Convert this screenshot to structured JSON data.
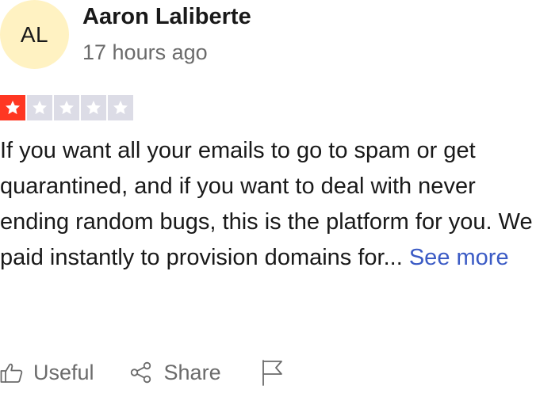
{
  "reviewer": {
    "initials": "AL",
    "name": "Aaron Laliberte",
    "date": "17 hours ago"
  },
  "rating": {
    "stars": 1,
    "max": 5,
    "filled_color": "#ff3722",
    "empty_color": "#dcdce6"
  },
  "review": {
    "text": "If you want all your emails to go to spam or get quarantined, and if you want to deal with never ending random bugs, this is the platform for you. We paid instantly to provision domains for...",
    "see_more_label": "See more"
  },
  "actions": {
    "useful_label": "Useful",
    "share_label": "Share",
    "icons": [
      "thumbs-up-icon",
      "share-icon",
      "flag-icon"
    ]
  },
  "colors": {
    "avatar_bg": "#fff2c2",
    "link": "#3b5bc5",
    "muted": "#6b6b6b"
  }
}
